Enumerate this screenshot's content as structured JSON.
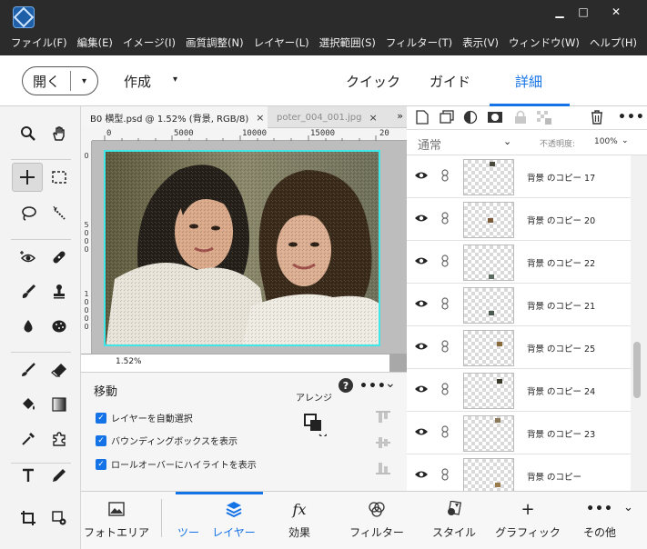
{
  "menu": [
    "ファイル(F)",
    "編集(E)",
    "イメージ(I)",
    "画質調整(N)",
    "レイヤー(L)",
    "選択範囲(S)",
    "フィルター(T)",
    "表示(V)",
    "ウィンドウ(W)",
    "ヘルプ(H)"
  ],
  "window_controls": {
    "minimize": "▁",
    "maximize": "□",
    "close": "✕"
  },
  "modebar": {
    "open_label": "開く",
    "open_arrow": "▾",
    "create_label": "作成",
    "create_arrow": "▾",
    "tabs": [
      "クイック",
      "ガイド",
      "詳細"
    ],
    "active_tab": "詳細",
    "accent": "#1473e6"
  },
  "doc_tabs": [
    {
      "label": "B0 横型.psd @ 1.52% (背景, RGB/8)",
      "close": "×"
    },
    {
      "label": "poter_004_001.jpg",
      "close": "×"
    }
  ],
  "tab_overflow": "»",
  "ruler": {
    "h_labels": [
      "0",
      "5000",
      "10000",
      "15000",
      "20"
    ],
    "v_labels": [
      [
        "0"
      ],
      [
        "5",
        "0",
        "0",
        "0"
      ],
      [
        "1",
        "0",
        "0",
        "0",
        "0"
      ]
    ]
  },
  "zoom": "1.52%",
  "tool_options": {
    "title": "移動",
    "help": "?",
    "more": "•••",
    "collapse": "⌄",
    "arrange_label": "アレンジ",
    "checkboxes": [
      {
        "label": "レイヤーを自動選択",
        "checked": true
      },
      {
        "label": "バウンディングボックスを表示",
        "checked": true
      },
      {
        "label": "ロールオーバーにハイライトを表示",
        "checked": true
      }
    ]
  },
  "layers_panel": {
    "more": "•••",
    "blend_mode": "通常",
    "blend_arrow": "⌄",
    "opacity_label": "不透明度:",
    "opacity_value": "100%",
    "opacity_arrow": "⌄",
    "layers": [
      {
        "name": "背景 のコピー 17"
      },
      {
        "name": "背景 のコピー 20"
      },
      {
        "name": "背景 のコピー 22"
      },
      {
        "name": "背景 のコピー 21"
      },
      {
        "name": "背景 のコピー 25"
      },
      {
        "name": "背景 のコピー 24"
      },
      {
        "name": "背景 のコピー 23"
      },
      {
        "name": "背景 のコピー"
      }
    ]
  },
  "bottom_bar": [
    {
      "label": "フォトエリア",
      "icon": "photo-bin-icon"
    },
    {
      "label": "ツー",
      "icon": "tool-options-icon"
    },
    {
      "label": "レイヤー",
      "icon": "layers-icon",
      "selected": true
    },
    {
      "label": "効果",
      "icon": "fx-icon"
    },
    {
      "label": "フィルター",
      "icon": "filter-icon"
    },
    {
      "label": "スタイル",
      "icon": "style-icon"
    },
    {
      "label": "グラフィック",
      "icon": "graphics-icon"
    },
    {
      "label": "その他",
      "icon": "more-icon"
    }
  ],
  "bottom_more_arrow": "⌄"
}
